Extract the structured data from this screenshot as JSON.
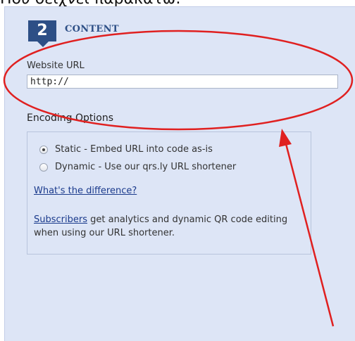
{
  "caption": "Πού δείχνει παρακάτω:",
  "step": {
    "number": "2",
    "title": "CONTENT"
  },
  "url_field": {
    "label": "Website URL",
    "value": "http://"
  },
  "encoding": {
    "title": "Encoding Options",
    "options": [
      {
        "label": "Static - Embed URL into code as-is",
        "selected": true
      },
      {
        "label": "Dynamic - Use our qrs.ly URL shortener",
        "selected": false
      }
    ],
    "difference_link": "What's the difference?",
    "subscribers_link": "Subscribers",
    "subscribers_text": " get analytics and dynamic QR code editing when using our URL shortener."
  },
  "colors": {
    "panel_bg": "#dde5f6",
    "badge": "#2d4f86",
    "annotation": "#e02020"
  }
}
